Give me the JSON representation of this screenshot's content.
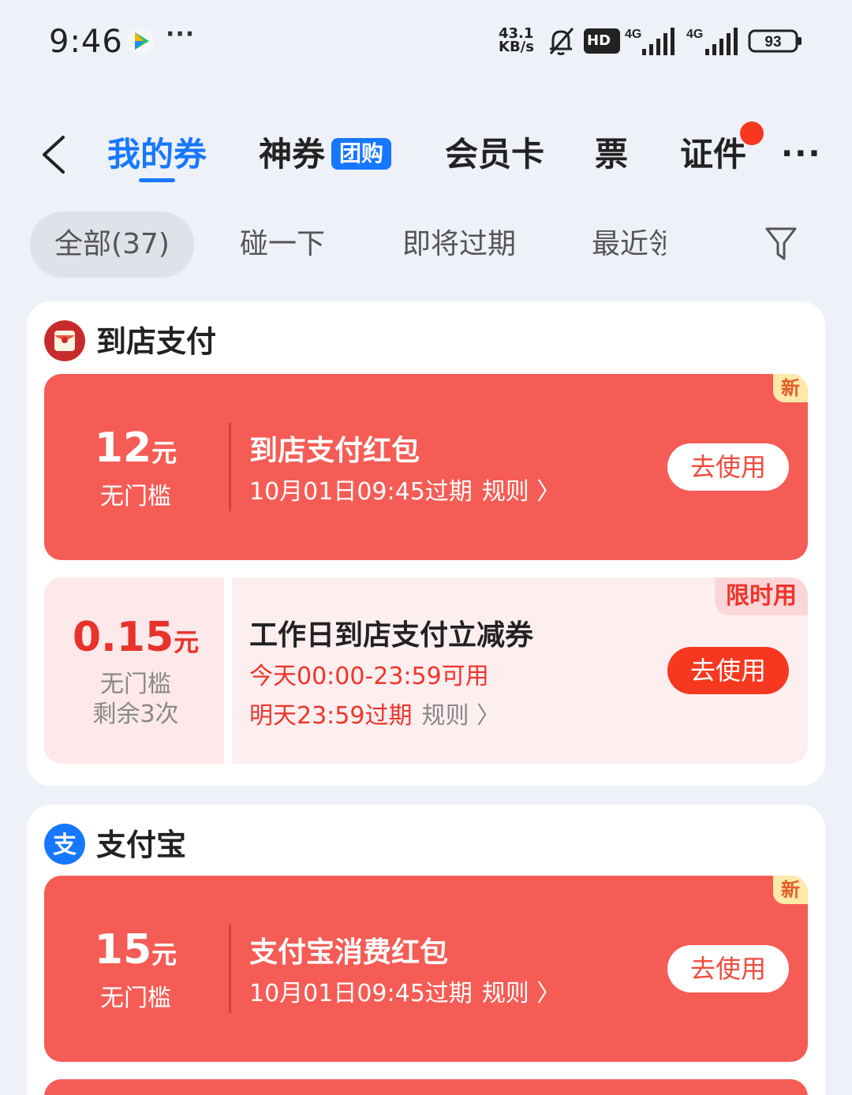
{
  "status_bar": {
    "time": "9:46",
    "more": "···",
    "net_speed_value": "43.1",
    "net_speed_unit": "KB/s",
    "hd_label": "HD",
    "sig1_label": "4G",
    "sig2_label": "4G",
    "battery": "93"
  },
  "nav": {
    "tabs": [
      {
        "label": "我的券"
      },
      {
        "label": "神券",
        "badge": "团购"
      },
      {
        "label": "会员卡"
      },
      {
        "label": "票"
      },
      {
        "label": "证件"
      }
    ],
    "more": "···"
  },
  "filters": {
    "chips": [
      "全部(37)",
      "碰一下",
      "即将过期",
      "最近领"
    ]
  },
  "groups": [
    {
      "title": "到店支付",
      "coupons": [
        {
          "amount": "12",
          "unit": "元",
          "condition": "无门槛",
          "title": "到店支付红包",
          "expiry": "10月01日09:45过期",
          "rule": "规则 〉",
          "button": "去使用",
          "tag": "新"
        },
        {
          "amount": "0.15",
          "unit": "元",
          "condition": "无门槛",
          "remaining": "剩余3次",
          "title": "工作日到店支付立减券",
          "availability": "今天00:00-23:59可用",
          "expiry": "明天23:59过期",
          "rule": "规则 〉",
          "button": "去使用",
          "tag": "限时用"
        }
      ]
    },
    {
      "title": "支付宝",
      "coupons": [
        {
          "amount": "15",
          "unit": "元",
          "condition": "无门槛",
          "title": "支付宝消费红包",
          "expiry": "10月01日09:45过期",
          "rule": "规则 〉",
          "button": "去使用",
          "tag": "新"
        }
      ]
    }
  ],
  "colors": {
    "accent_blue": "#1677ff",
    "coupon_red": "#f55c55",
    "button_red": "#f5381f",
    "page_bg": "#eef1f7"
  },
  "icons": [
    "back-arrow-icon",
    "filter-icon",
    "red-envelope-icon",
    "alipay-logo-icon",
    "bell-muted-icon",
    "signal-icon",
    "battery-icon"
  ]
}
